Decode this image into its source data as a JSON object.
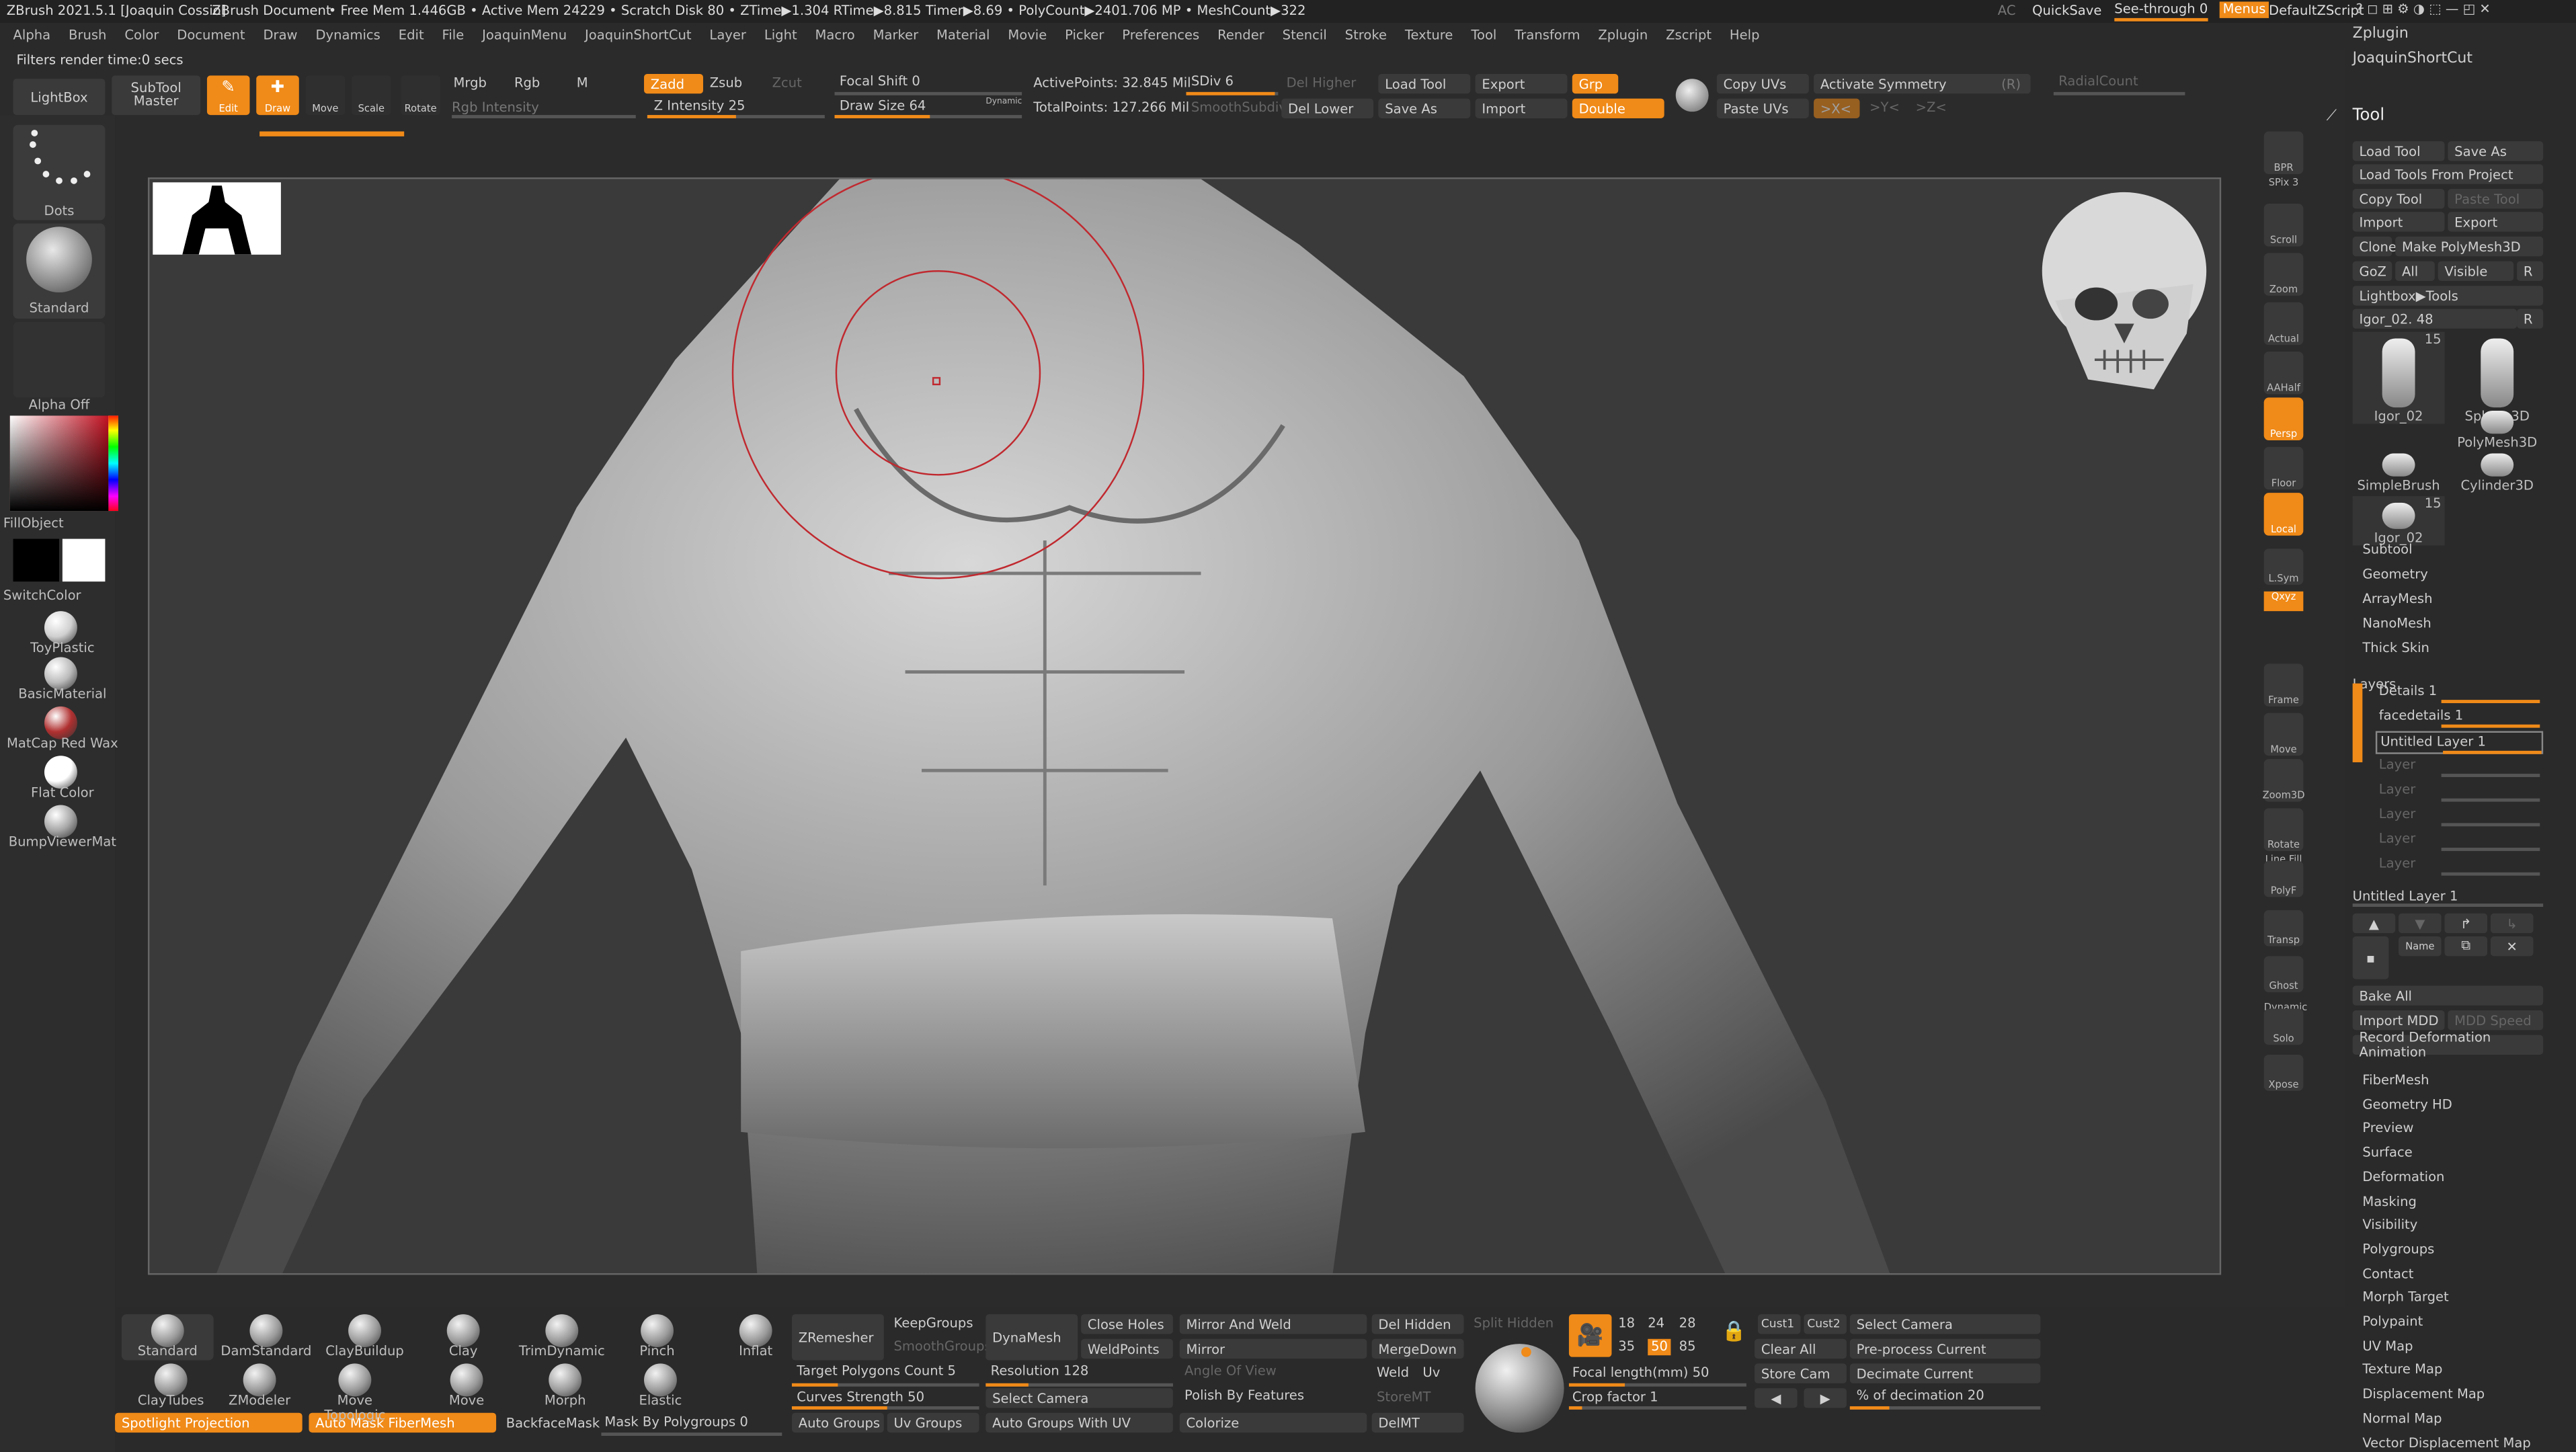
{
  "title_bar": {
    "app": "ZBrush 2021.5.1 [Joaquin Cossio]",
    "document": "ZBrush Document",
    "stats": "• Free Mem 1.446GB • Active Mem 24229 • Scratch Disk 80 • ZTime▶1.304 RTime▶8.815 Timer▶8.69 • PolyCount▶2401.706 MP • MeshCount▶322",
    "ac": "AC",
    "quicksave": "QuickSave",
    "see_through": "See-through  0",
    "menus": "Menus",
    "default_script": "DefaultZScript"
  },
  "menu": [
    "Alpha",
    "Brush",
    "Color",
    "Document",
    "Draw",
    "Dynamics",
    "Edit",
    "File",
    "JoaquinMenu",
    "JoaquinShortCut",
    "Layer",
    "Light",
    "Macro",
    "Marker",
    "Material",
    "Movie",
    "Picker",
    "Preferences",
    "Render",
    "Stencil",
    "Stroke",
    "Texture",
    "Tool",
    "Transform",
    "Zplugin",
    "Zscript",
    "Help"
  ],
  "status": "Filters render time:0 secs",
  "top": {
    "lightbox": "LightBox",
    "subtool_master": "SubTool Master",
    "edit": "Edit",
    "draw": "Draw",
    "move": "Move",
    "scale": "Scale",
    "rotate": "Rotate",
    "mrgb": "Mrgb",
    "rgb": "Rgb",
    "m": "M",
    "rgb_intensity": "Rgb Intensity",
    "zadd": "Zadd",
    "zsub": "Zsub",
    "zcut": "Zcut",
    "z_intensity": "Z Intensity 25",
    "focal_shift": "Focal Shift 0",
    "draw_size": "Draw Size 64",
    "dynamic": "Dynamic",
    "active_points": "ActivePoints: 32.845 Mil",
    "total_points": "TotalPoints: 127.266 Mil",
    "sdiv": "SDiv 6",
    "smooth_subdiv": "SmoothSubdiv",
    "del_higher": "Del Higher",
    "del_lower": "Del Lower",
    "load_tool": "Load Tool",
    "save_as": "Save As",
    "export": "Export",
    "import": "Import",
    "grp": "Grp",
    "double": "Double",
    "copy_uvs": "Copy UVs",
    "paste_uvs": "Paste UVs",
    "activate_symmetry": "Activate Symmetry",
    "r": "(R)",
    "radial_count": "RadialCount",
    "x": ">X<",
    "y": ">Y<",
    "z": ">Z<"
  },
  "left": {
    "dots": "Dots",
    "standard": "Standard",
    "alpha_off": "Alpha Off",
    "fill_object": "FillObject",
    "switch_color": "SwitchColor",
    "materials": [
      "ToyPlastic",
      "BasicMaterial",
      "MatCap Red Wax",
      "Flat Color",
      "BumpViewerMat"
    ]
  },
  "right_tools": [
    "BPR",
    "SPix 3",
    "Scroll",
    "Zoom",
    "Actual",
    "AAHalf",
    "Persp",
    "Floor",
    "Local",
    "L.Sym",
    "Qxyz",
    "Frame",
    "Move",
    "Zoom3D",
    "Rotate",
    "Line Fill",
    "PolyF",
    "Transp",
    "Ghost",
    "Dynamic",
    "Solo",
    "Xpose"
  ],
  "right_panel": {
    "zplugin": "Zplugin",
    "joaquin": "JoaquinShortCut",
    "tool": "Tool",
    "load_tool": "Load Tool",
    "save_as": "Save As",
    "load_from_project": "Load Tools From Project",
    "copy_tool": "Copy Tool",
    "paste_tool": "Paste Tool",
    "import": "Import",
    "export": "Export",
    "clone": "Clone",
    "make_polymesh": "Make PolyMesh3D",
    "goz": "GoZ",
    "all": "All",
    "visible": "Visible",
    "r": "R",
    "lightbox_tools": "Lightbox▶Tools",
    "tool_name": "Igor_02. 48",
    "thumbs": [
      {
        "label": "Igor_02",
        "count": "15"
      },
      {
        "label": "Sphere3D",
        "count": ""
      },
      {
        "label": "PolyMesh3D",
        "count": ""
      },
      {
        "label": "SimpleBrush",
        "count": ""
      },
      {
        "label": "Cylinder3D",
        "count": ""
      },
      {
        "label": "Igor_02",
        "count": "15"
      }
    ],
    "sections": [
      "Subtool",
      "Geometry",
      "ArrayMesh",
      "NanoMesh",
      "Thick Skin"
    ],
    "layers_header": "Layers",
    "layers": [
      "Details 1",
      "facedetails 1",
      "Untitled Layer 1",
      "Layer",
      "Layer",
      "Layer",
      "Layer",
      "Layer"
    ],
    "untitled_layer": "Untitled Layer 1",
    "name_btn": "Name",
    "bake_all": "Bake All",
    "import_mdd": "Import MDD",
    "mdd_speed": "MDD Speed",
    "record_deformation": "Record Deformation Animation",
    "sections2": [
      "FiberMesh",
      "Geometry HD",
      "Preview",
      "Surface",
      "Deformation",
      "Masking",
      "Visibility",
      "Polygroups",
      "Contact",
      "Morph Target",
      "Polypaint",
      "UV Map",
      "Texture Map",
      "Displacement Map",
      "Normal Map",
      "Vector Displacement Map"
    ]
  },
  "bottom": {
    "brushes_row1": [
      "Standard",
      "DamStandard",
      "ClayBuildup",
      "Clay",
      "TrimDynamic",
      "Pinch",
      "Inflat"
    ],
    "brushes_row2": [
      "ClayTubes",
      "ZModeler",
      "Move Topologic",
      "Move",
      "Morph",
      "Elastic"
    ],
    "spotlight": "Spotlight Projection",
    "auto_mask": "Auto Mask FiberMesh",
    "backface": "BackfaceMask",
    "mask_polygroups": "Mask By Polygroups 0",
    "zremesher": "ZRemesher",
    "keep_groups": "KeepGroups",
    "smooth_groups": "SmoothGroups",
    "target_poly": "Target Polygons Count 5",
    "curves": "Curves Strength 50",
    "auto_groups": "Auto Groups",
    "uv_groups": "Uv Groups",
    "dynamesh": "DynaMesh",
    "resolution": "Resolution 128",
    "select_camera_left": "Select Camera",
    "auto_groups_uv": "Auto Groups With UV",
    "close_holes": "Close Holes",
    "weld_points": "WeldPoints",
    "mirror_weld": "Mirror And Weld",
    "mirror": "Mirror",
    "angle_view": "Angle Of View",
    "polish": "Polish By Features",
    "colorize": "Colorize",
    "del_hidden": "Del Hidden",
    "split_hidden": "Split Hidden",
    "merge_down": "MergeDown",
    "weld": "Weld",
    "uv": "Uv",
    "store_mt": "StoreMT",
    "del_mt": "DelMT",
    "focal_nums": [
      "18",
      "24",
      "28",
      "35",
      "50",
      "85"
    ],
    "focal_length": "Focal length(mm) 50",
    "crop": "Crop factor 1",
    "cust1": "Cust1",
    "cust2": "Cust2",
    "clear_all": "Clear All",
    "store_cam": "Store Cam",
    "select_camera": "Select Camera",
    "preprocess": "Pre-process Current",
    "decimate": "Decimate Current",
    "pct_decimation": "% of decimation 20"
  }
}
